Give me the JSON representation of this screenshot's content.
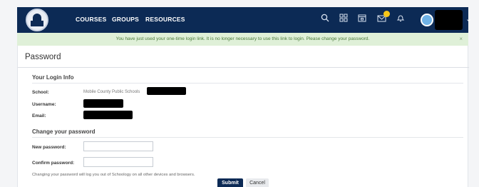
{
  "nav": {
    "links": [
      "COURSES",
      "GROUPS",
      "RESOURCES"
    ],
    "icons": [
      "search-icon",
      "apps-grid-icon",
      "calendar-icon",
      "messages-icon",
      "notifications-bell-icon"
    ],
    "notification_badge_color": "#f5c518",
    "background_color": "#0c2a55"
  },
  "alert": {
    "message": "You have just used your one-time login link. It is no longer necessary to use this link to login. Please change your password.",
    "close": "×"
  },
  "page": {
    "title": "Password"
  },
  "login_info": {
    "heading": "Your Login Info",
    "school_label": "School:",
    "school_value": "Mobile County Public Schools",
    "username_label": "Username:",
    "email_label": "Email:"
  },
  "change_password": {
    "heading": "Change your password",
    "new_label": "New password:",
    "confirm_label": "Confirm password:",
    "help_text": "Changing your password will log you out of Schoology on all other devices and browsers.",
    "submit_label": "Submit",
    "cancel_label": "Cancel"
  }
}
